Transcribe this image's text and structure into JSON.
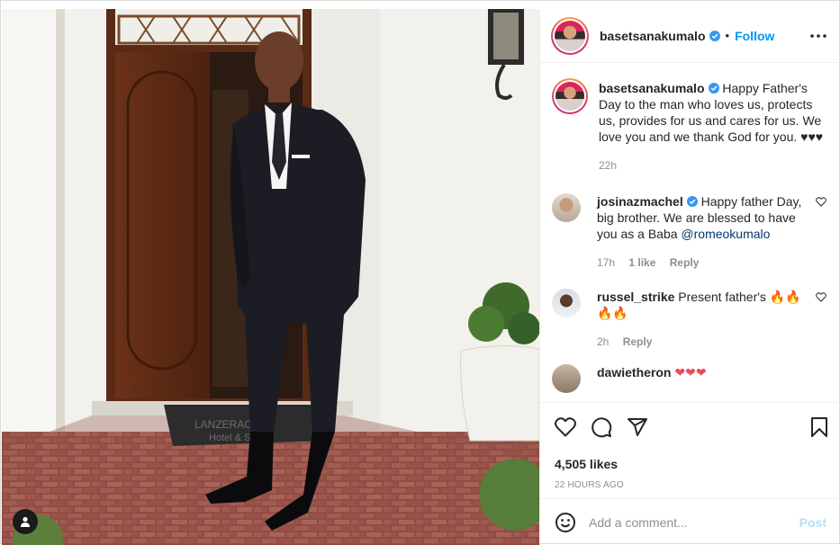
{
  "post": {
    "username": "basetsanakumalo",
    "follow_label": "Follow",
    "separator": "•"
  },
  "caption": {
    "username": "basetsanakumalo",
    "text": "Happy Father's Day to the man who loves us, protects us, provides for us and cares for us. We love you and we thank God for you. ♥♥♥",
    "time": "22h"
  },
  "comments": [
    {
      "username": "josinazmachel",
      "verified": true,
      "text": "Happy father Day, big brother. We are blessed to have you as a Baba",
      "mention": "@romeokumalo",
      "time": "17h",
      "likes": "1 like",
      "reply": "Reply"
    },
    {
      "username": "russel_strike",
      "verified": false,
      "text": "Present father's 🔥🔥🔥🔥",
      "time": "2h",
      "reply": "Reply"
    },
    {
      "username": "dawietheron",
      "verified": false,
      "text": "❤❤❤"
    }
  ],
  "stats": {
    "likes": "4,505 likes",
    "posted": "22 HOURS AGO"
  },
  "add_comment": {
    "placeholder": "Add a comment...",
    "post_label": "Post"
  },
  "photo_sign": {
    "line1": "LANZERAC",
    "line2": "Hotel & Spa"
  },
  "colors": {
    "accent": "#0095f6",
    "verified": "#3897f0",
    "post_disabled": "#b2dffc",
    "muted": "#8e8e8e"
  },
  "icons": [
    "verified-icon",
    "more-icon",
    "heart-icon",
    "comment-icon",
    "share-icon",
    "bookmark-icon",
    "emoji-icon",
    "user-tag-icon"
  ]
}
